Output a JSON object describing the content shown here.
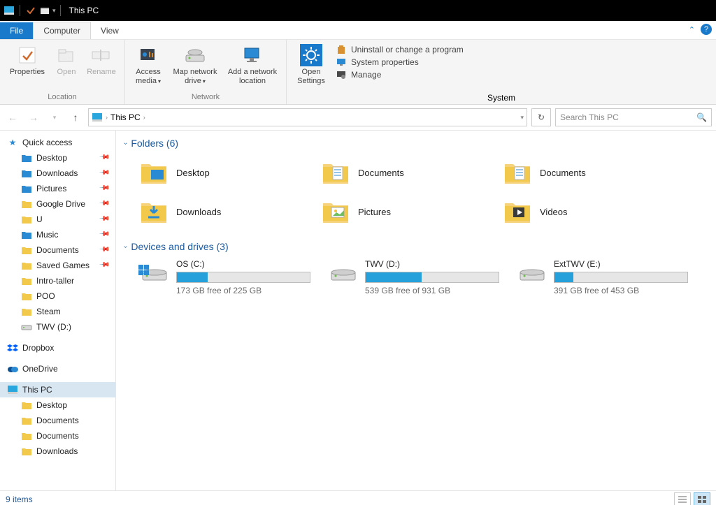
{
  "titlebar": {
    "title": "This PC"
  },
  "tabs": {
    "file": "File",
    "computer": "Computer",
    "view": "View"
  },
  "ribbon": {
    "location": {
      "properties": "Properties",
      "open": "Open",
      "rename": "Rename",
      "label": "Location"
    },
    "network": {
      "access_media": "Access media",
      "map_drive": "Map network drive",
      "add_loc": "Add a network location",
      "label": "Network"
    },
    "system": {
      "open_settings": "Open Settings",
      "uninstall": "Uninstall or change a program",
      "sys_props": "System properties",
      "manage": "Manage",
      "label": "System"
    }
  },
  "addressbar": {
    "crumb": "This PC",
    "dropdown_chev": "▾"
  },
  "search": {
    "placeholder": "Search This PC"
  },
  "navpane": {
    "quick_access": "Quick access",
    "qa_items": [
      "Desktop",
      "Downloads",
      "Pictures",
      "Google Drive",
      "U",
      "Music",
      "Documents",
      "Saved Games",
      "Intro-taller",
      "POO",
      "Steam",
      "TWV (D:)"
    ],
    "dropbox": "Dropbox",
    "onedrive": "OneDrive",
    "this_pc": "This PC",
    "pc_items": [
      "Desktop",
      "Documents",
      "Documents",
      "Downloads"
    ]
  },
  "groups": {
    "folders_header": "Folders (6)",
    "drives_header": "Devices and drives (3)",
    "folders": [
      "Desktop",
      "Documents",
      "Documents",
      "Downloads",
      "Pictures",
      "Videos"
    ]
  },
  "drives": [
    {
      "name": "OS (C:)",
      "free_text": "173 GB free of 225 GB",
      "fill_pct": 23
    },
    {
      "name": "TWV (D:)",
      "free_text": "539 GB free of 931 GB",
      "fill_pct": 42
    },
    {
      "name": "ExtTWV (E:)",
      "free_text": "391 GB free of 453 GB",
      "fill_pct": 14
    }
  ],
  "status": {
    "count": "9 items"
  }
}
